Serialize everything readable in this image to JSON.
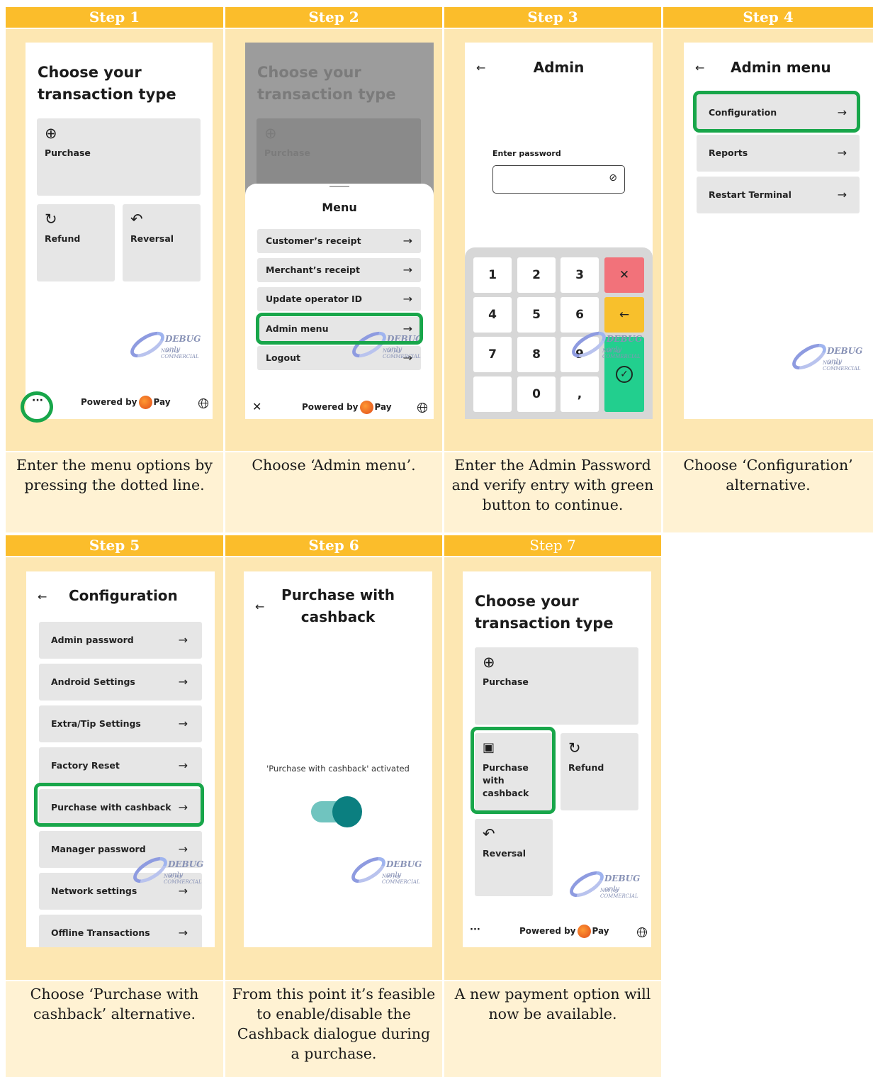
{
  "steps": {
    "s1": {
      "header": "Step 1",
      "caption": "Enter the menu options by pressing the dotted line."
    },
    "s2": {
      "header": "Step 2",
      "caption": "Choose ‘Admin menu’."
    },
    "s3": {
      "header": "Step 3",
      "caption": "Enter the Admin Password and verify entry with green button to continue."
    },
    "s4": {
      "header": "Step 4",
      "caption": "Choose ‘Configuration’ alternative."
    },
    "s5": {
      "header": "Step 5",
      "caption": "Choose ‘Purchase with cashback’ alternative."
    },
    "s6": {
      "header": "Step 6",
      "caption": "From this point it’s feasible to enable/disable the Cashback dialogue during a purchase."
    },
    "s7": {
      "header": "Step 7",
      "caption": "A new payment option will now be available."
    }
  },
  "home": {
    "title_line1": "Choose your",
    "title_line2": "transaction type",
    "purchase": "Purchase",
    "refund": "Refund",
    "reversal": "Reversal",
    "purchase_cashback": "Purchase with cashback"
  },
  "footer": {
    "powered_by": "Powered by",
    "pay": "Pay",
    "dots": "···"
  },
  "menu": {
    "title": "Menu",
    "items": [
      "Customer’s receipt",
      "Merchant’s receipt",
      "Update operator ID",
      "Admin menu",
      "Logout"
    ]
  },
  "admin": {
    "title": "Admin",
    "password_label": "Enter password",
    "keys": [
      "1",
      "2",
      "3",
      "4",
      "5",
      "6",
      "7",
      "8",
      "9",
      "0",
      ","
    ]
  },
  "admin_menu": {
    "title": "Admin menu",
    "items": [
      "Configuration",
      "Reports",
      "Restart Terminal"
    ]
  },
  "configuration": {
    "title": "Configuration",
    "items": [
      "Admin password",
      "Android Settings",
      "Extra/Tip Settings",
      "Factory Reset",
      "Purchase with cashback",
      "Manager password",
      "Network settings",
      "Offline Transactions"
    ]
  },
  "cashback": {
    "title_line1": "Purchase with",
    "title_line2": "cashback",
    "status": "'Purchase with cashback' activated",
    "enabled": true
  },
  "watermark": {
    "brand": "DEBUG",
    "suffix": "only",
    "note": "Not for COMMERCIAL"
  },
  "colors": {
    "header": "#fbbd2b",
    "highlight": "#18a64a",
    "cancel": "#f2727a",
    "backspace": "#f8c02c",
    "confirm": "#22cf8e",
    "toggle": "#0b7f80"
  }
}
